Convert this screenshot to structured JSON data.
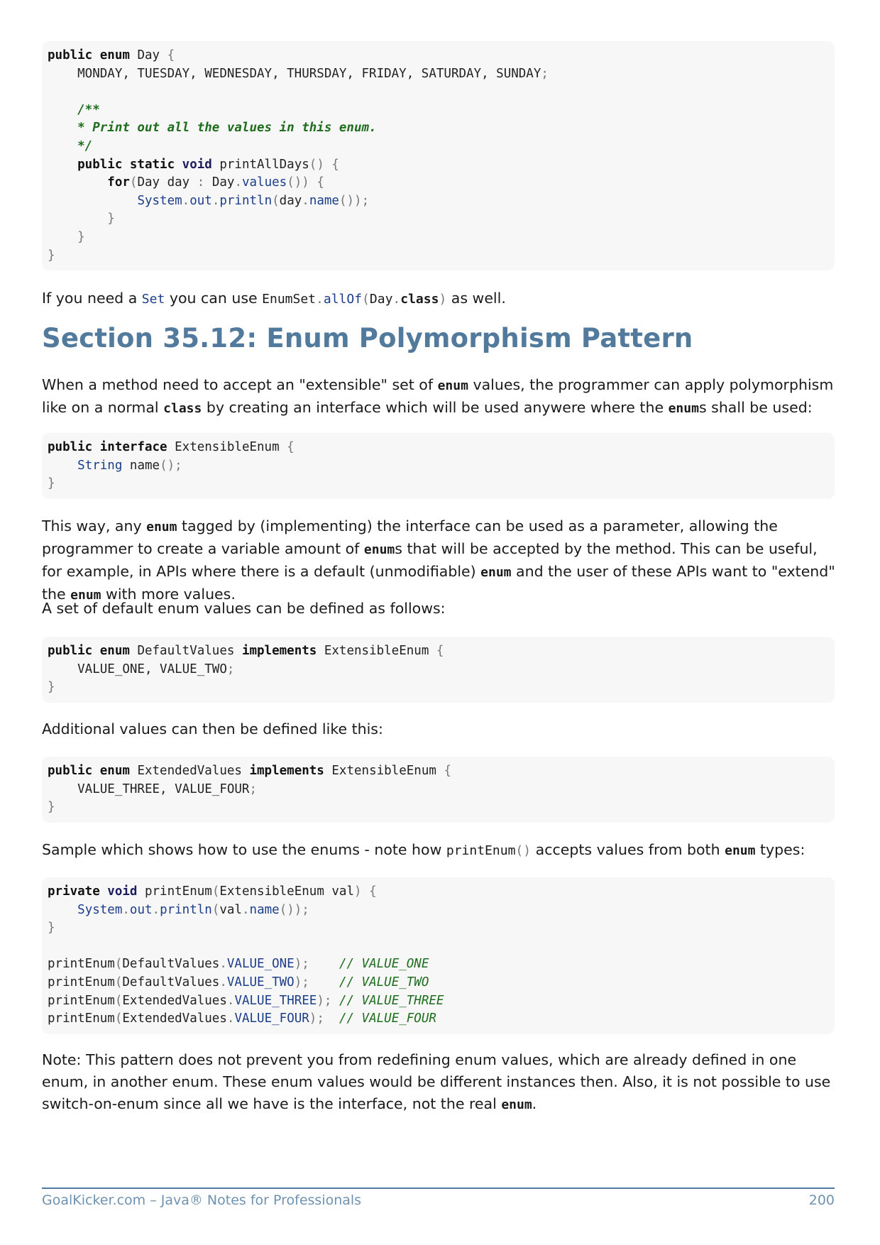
{
  "code_block_1": {
    "lines": [
      [
        {
          "t": "public enum ",
          "c": "kw"
        },
        {
          "t": "Day ",
          "c": ""
        },
        {
          "t": "{",
          "c": "p"
        }
      ],
      [
        {
          "t": "    MONDAY, TUESDAY, WEDNESDAY, THURSDAY, FRIDAY, SATURDAY, SUNDAY",
          "c": ""
        },
        {
          "t": ";",
          "c": "p"
        }
      ],
      [],
      [
        {
          "t": "    /**",
          "c": "cmb"
        }
      ],
      [
        {
          "t": "    * Print out all the values in this enum.",
          "c": "cmb"
        }
      ],
      [
        {
          "t": "    */",
          "c": "cmb"
        }
      ],
      [
        {
          "t": "    public static ",
          "c": "kw"
        },
        {
          "t": "void ",
          "c": "kt"
        },
        {
          "t": "printAllDays",
          "c": ""
        },
        {
          "t": "() {",
          "c": "p"
        }
      ],
      [
        {
          "t": "        for",
          "c": "kw"
        },
        {
          "t": "(",
          "c": "p"
        },
        {
          "t": "Day day ",
          "c": ""
        },
        {
          "t": ": ",
          "c": "p"
        },
        {
          "t": "Day",
          "c": ""
        },
        {
          "t": ".",
          "c": "p"
        },
        {
          "t": "values",
          "c": "fn"
        },
        {
          "t": "()) {",
          "c": "p"
        }
      ],
      [
        {
          "t": "            ",
          "c": ""
        },
        {
          "t": "System",
          "c": "ty"
        },
        {
          "t": ".",
          "c": "p"
        },
        {
          "t": "out",
          "c": "fn"
        },
        {
          "t": ".",
          "c": "p"
        },
        {
          "t": "println",
          "c": "fn"
        },
        {
          "t": "(",
          "c": "p"
        },
        {
          "t": "day",
          "c": ""
        },
        {
          "t": ".",
          "c": "p"
        },
        {
          "t": "name",
          "c": "fn"
        },
        {
          "t": "());",
          "c": "p"
        }
      ],
      [
        {
          "t": "        }",
          "c": "p"
        }
      ],
      [
        {
          "t": "    }",
          "c": "p"
        }
      ],
      [
        {
          "t": "}",
          "c": "p"
        }
      ]
    ]
  },
  "para_set": [
    {
      "t": "If you need a ",
      "c": ""
    },
    {
      "t": "Set",
      "c": "ic ic-ty"
    },
    {
      "t": " you can use ",
      "c": ""
    },
    {
      "t": "EnumSet",
      "c": "ic"
    },
    {
      "t": ".",
      "c": "ic ic-p"
    },
    {
      "t": "allOf",
      "c": "ic ic-ty"
    },
    {
      "t": "(",
      "c": "ic ic-p"
    },
    {
      "t": "Day",
      "c": "ic"
    },
    {
      "t": ".",
      "c": "ic ic-p"
    },
    {
      "t": "class",
      "c": "ic-b"
    },
    {
      "t": ")",
      "c": "ic ic-p"
    },
    {
      "t": " as well.",
      "c": ""
    }
  ],
  "section_heading": "Section 35.12: Enum Polymorphism Pattern",
  "para_intro": [
    {
      "t": "When a method need to accept an \"extensible\" set of ",
      "c": ""
    },
    {
      "t": "enum",
      "c": "ic-b"
    },
    {
      "t": " values, the programmer can apply polymorphism like on a normal ",
      "c": ""
    },
    {
      "t": "class",
      "c": "ic-b"
    },
    {
      "t": " by creating an interface which will be used anywere where the ",
      "c": ""
    },
    {
      "t": "enum",
      "c": "ic-b"
    },
    {
      "t": "s shall be used:",
      "c": ""
    }
  ],
  "code_block_2": {
    "lines": [
      [
        {
          "t": "public interface ",
          "c": "kw"
        },
        {
          "t": "ExtensibleEnum ",
          "c": ""
        },
        {
          "t": "{",
          "c": "p"
        }
      ],
      [
        {
          "t": "    ",
          "c": ""
        },
        {
          "t": "String",
          "c": "ty"
        },
        {
          "t": " name",
          "c": ""
        },
        {
          "t": "();",
          "c": "p"
        }
      ],
      [
        {
          "t": "}",
          "c": "p"
        }
      ]
    ]
  },
  "para_way": [
    {
      "t": "This way, any ",
      "c": ""
    },
    {
      "t": "enum",
      "c": "ic-b"
    },
    {
      "t": " tagged by (implementing) the interface can be used as a parameter, allowing the programmer to create a variable amount of ",
      "c": ""
    },
    {
      "t": "enum",
      "c": "ic-b"
    },
    {
      "t": "s that will be accepted by the method. This can be useful, for example, in APIs where there is a default (unmodifiable) ",
      "c": ""
    },
    {
      "t": "enum",
      "c": "ic-b"
    },
    {
      "t": " and the user of these APIs want to \"extend\" the ",
      "c": ""
    },
    {
      "t": "enum",
      "c": "ic-b"
    },
    {
      "t": " with more values.",
      "c": ""
    }
  ],
  "para_default": "A set of default enum values can be defined as follows:",
  "code_block_3": {
    "lines": [
      [
        {
          "t": "public enum ",
          "c": "kw"
        },
        {
          "t": "DefaultValues ",
          "c": ""
        },
        {
          "t": "implements ",
          "c": "kw"
        },
        {
          "t": "ExtensibleEnum ",
          "c": ""
        },
        {
          "t": "{",
          "c": "p"
        }
      ],
      [
        {
          "t": "    VALUE_ONE, VALUE_TWO",
          "c": ""
        },
        {
          "t": ";",
          "c": "p"
        }
      ],
      [
        {
          "t": "}",
          "c": "p"
        }
      ]
    ]
  },
  "para_additional": "Additional values can then be defined like this:",
  "code_block_4": {
    "lines": [
      [
        {
          "t": "public enum ",
          "c": "kw"
        },
        {
          "t": "ExtendedValues ",
          "c": ""
        },
        {
          "t": "implements ",
          "c": "kw"
        },
        {
          "t": "ExtensibleEnum ",
          "c": ""
        },
        {
          "t": "{",
          "c": "p"
        }
      ],
      [
        {
          "t": "    VALUE_THREE, VALUE_FOUR",
          "c": ""
        },
        {
          "t": ";",
          "c": "p"
        }
      ],
      [
        {
          "t": "}",
          "c": "p"
        }
      ]
    ]
  },
  "para_sample": [
    {
      "t": "Sample which shows how to use the enums - note how ",
      "c": ""
    },
    {
      "t": "printEnum",
      "c": "ic"
    },
    {
      "t": "()",
      "c": "ic ic-p"
    },
    {
      "t": " accepts values from both ",
      "c": ""
    },
    {
      "t": "enum",
      "c": "ic-b"
    },
    {
      "t": " types:",
      "c": ""
    }
  ],
  "code_block_5": {
    "lines": [
      [
        {
          "t": "private ",
          "c": "kw"
        },
        {
          "t": "void ",
          "c": "kt"
        },
        {
          "t": "printEnum",
          "c": ""
        },
        {
          "t": "(",
          "c": "p"
        },
        {
          "t": "ExtensibleEnum val",
          "c": ""
        },
        {
          "t": ") {",
          "c": "p"
        }
      ],
      [
        {
          "t": "    ",
          "c": ""
        },
        {
          "t": "System",
          "c": "ty"
        },
        {
          "t": ".",
          "c": "p"
        },
        {
          "t": "out",
          "c": "fn"
        },
        {
          "t": ".",
          "c": "p"
        },
        {
          "t": "println",
          "c": "fn"
        },
        {
          "t": "(",
          "c": "p"
        },
        {
          "t": "val",
          "c": ""
        },
        {
          "t": ".",
          "c": "p"
        },
        {
          "t": "name",
          "c": "fn"
        },
        {
          "t": "());",
          "c": "p"
        }
      ],
      [
        {
          "t": "}",
          "c": "p"
        }
      ],
      [],
      [
        {
          "t": "printEnum",
          "c": ""
        },
        {
          "t": "(",
          "c": "p"
        },
        {
          "t": "DefaultValues",
          "c": ""
        },
        {
          "t": ".",
          "c": "p"
        },
        {
          "t": "VALUE_ONE",
          "c": "fn"
        },
        {
          "t": ");    ",
          "c": "p"
        },
        {
          "t": "// VALUE_ONE",
          "c": "cm"
        }
      ],
      [
        {
          "t": "printEnum",
          "c": ""
        },
        {
          "t": "(",
          "c": "p"
        },
        {
          "t": "DefaultValues",
          "c": ""
        },
        {
          "t": ".",
          "c": "p"
        },
        {
          "t": "VALUE_TWO",
          "c": "fn"
        },
        {
          "t": ");    ",
          "c": "p"
        },
        {
          "t": "// VALUE_TWO",
          "c": "cm"
        }
      ],
      [
        {
          "t": "printEnum",
          "c": ""
        },
        {
          "t": "(",
          "c": "p"
        },
        {
          "t": "ExtendedValues",
          "c": ""
        },
        {
          "t": ".",
          "c": "p"
        },
        {
          "t": "VALUE_THREE",
          "c": "fn"
        },
        {
          "t": "); ",
          "c": "p"
        },
        {
          "t": "// VALUE_THREE",
          "c": "cm"
        }
      ],
      [
        {
          "t": "printEnum",
          "c": ""
        },
        {
          "t": "(",
          "c": "p"
        },
        {
          "t": "ExtendedValues",
          "c": ""
        },
        {
          "t": ".",
          "c": "p"
        },
        {
          "t": "VALUE_FOUR",
          "c": "fn"
        },
        {
          "t": ");  ",
          "c": "p"
        },
        {
          "t": "// VALUE_FOUR",
          "c": "cm"
        }
      ]
    ]
  },
  "para_note": [
    {
      "t": "Note: This pattern does not prevent you from redefining enum values, which are already defined in one enum, in another enum. These enum values would be different instances then. Also, it is not possible to use switch-on-enum since all we have is the interface, not the real ",
      "c": ""
    },
    {
      "t": "enum",
      "c": "ic-b"
    },
    {
      "t": ".",
      "c": ""
    }
  ],
  "footer": {
    "left": "GoalKicker.com – Java® Notes for Professionals",
    "page_number": "200"
  }
}
